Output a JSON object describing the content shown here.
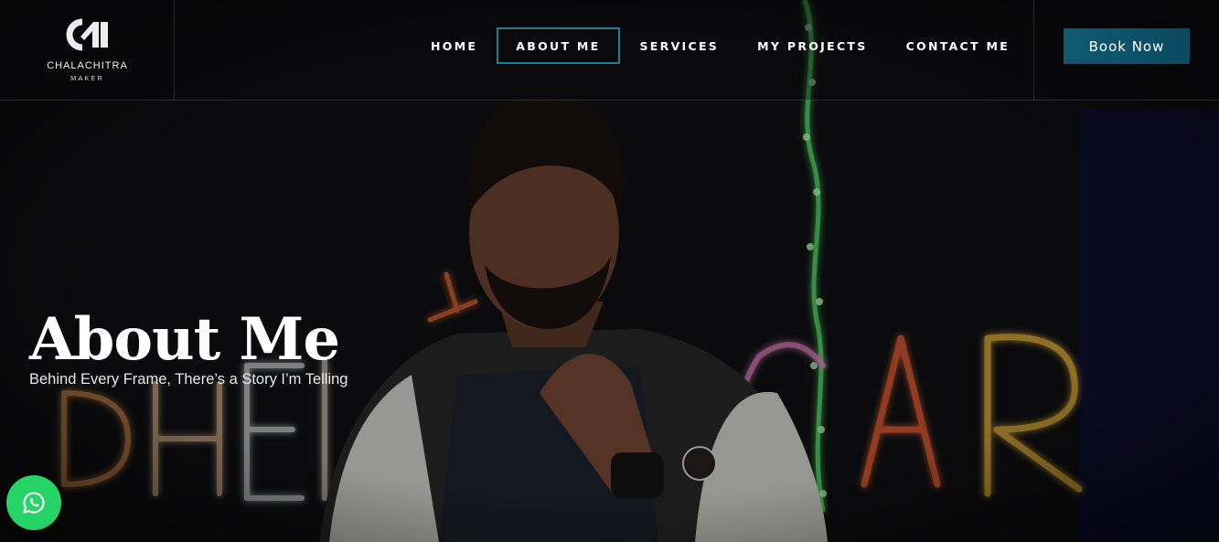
{
  "brand": {
    "name": "CHALACHITRA",
    "sub": "MAKER",
    "logo_icon": "cm-monogram-logo"
  },
  "nav": {
    "items": [
      {
        "label": "HOME",
        "active": false
      },
      {
        "label": "ABOUT ME",
        "active": true
      },
      {
        "label": "SERVICES",
        "active": false
      },
      {
        "label": "MY PROJECTS",
        "active": false
      },
      {
        "label": "CONTACT ME",
        "active": false
      }
    ],
    "accent": "#1f7f99"
  },
  "cta": {
    "label": "Book Now",
    "color": "#0e5a72"
  },
  "hero": {
    "title": "About Me",
    "subtitle": "Behind Every Frame, There’s a Story I’m Telling",
    "image": "portrait-with-neon-lights-background"
  },
  "whatsapp": {
    "icon": "whatsapp-icon",
    "color": "#25d366"
  }
}
